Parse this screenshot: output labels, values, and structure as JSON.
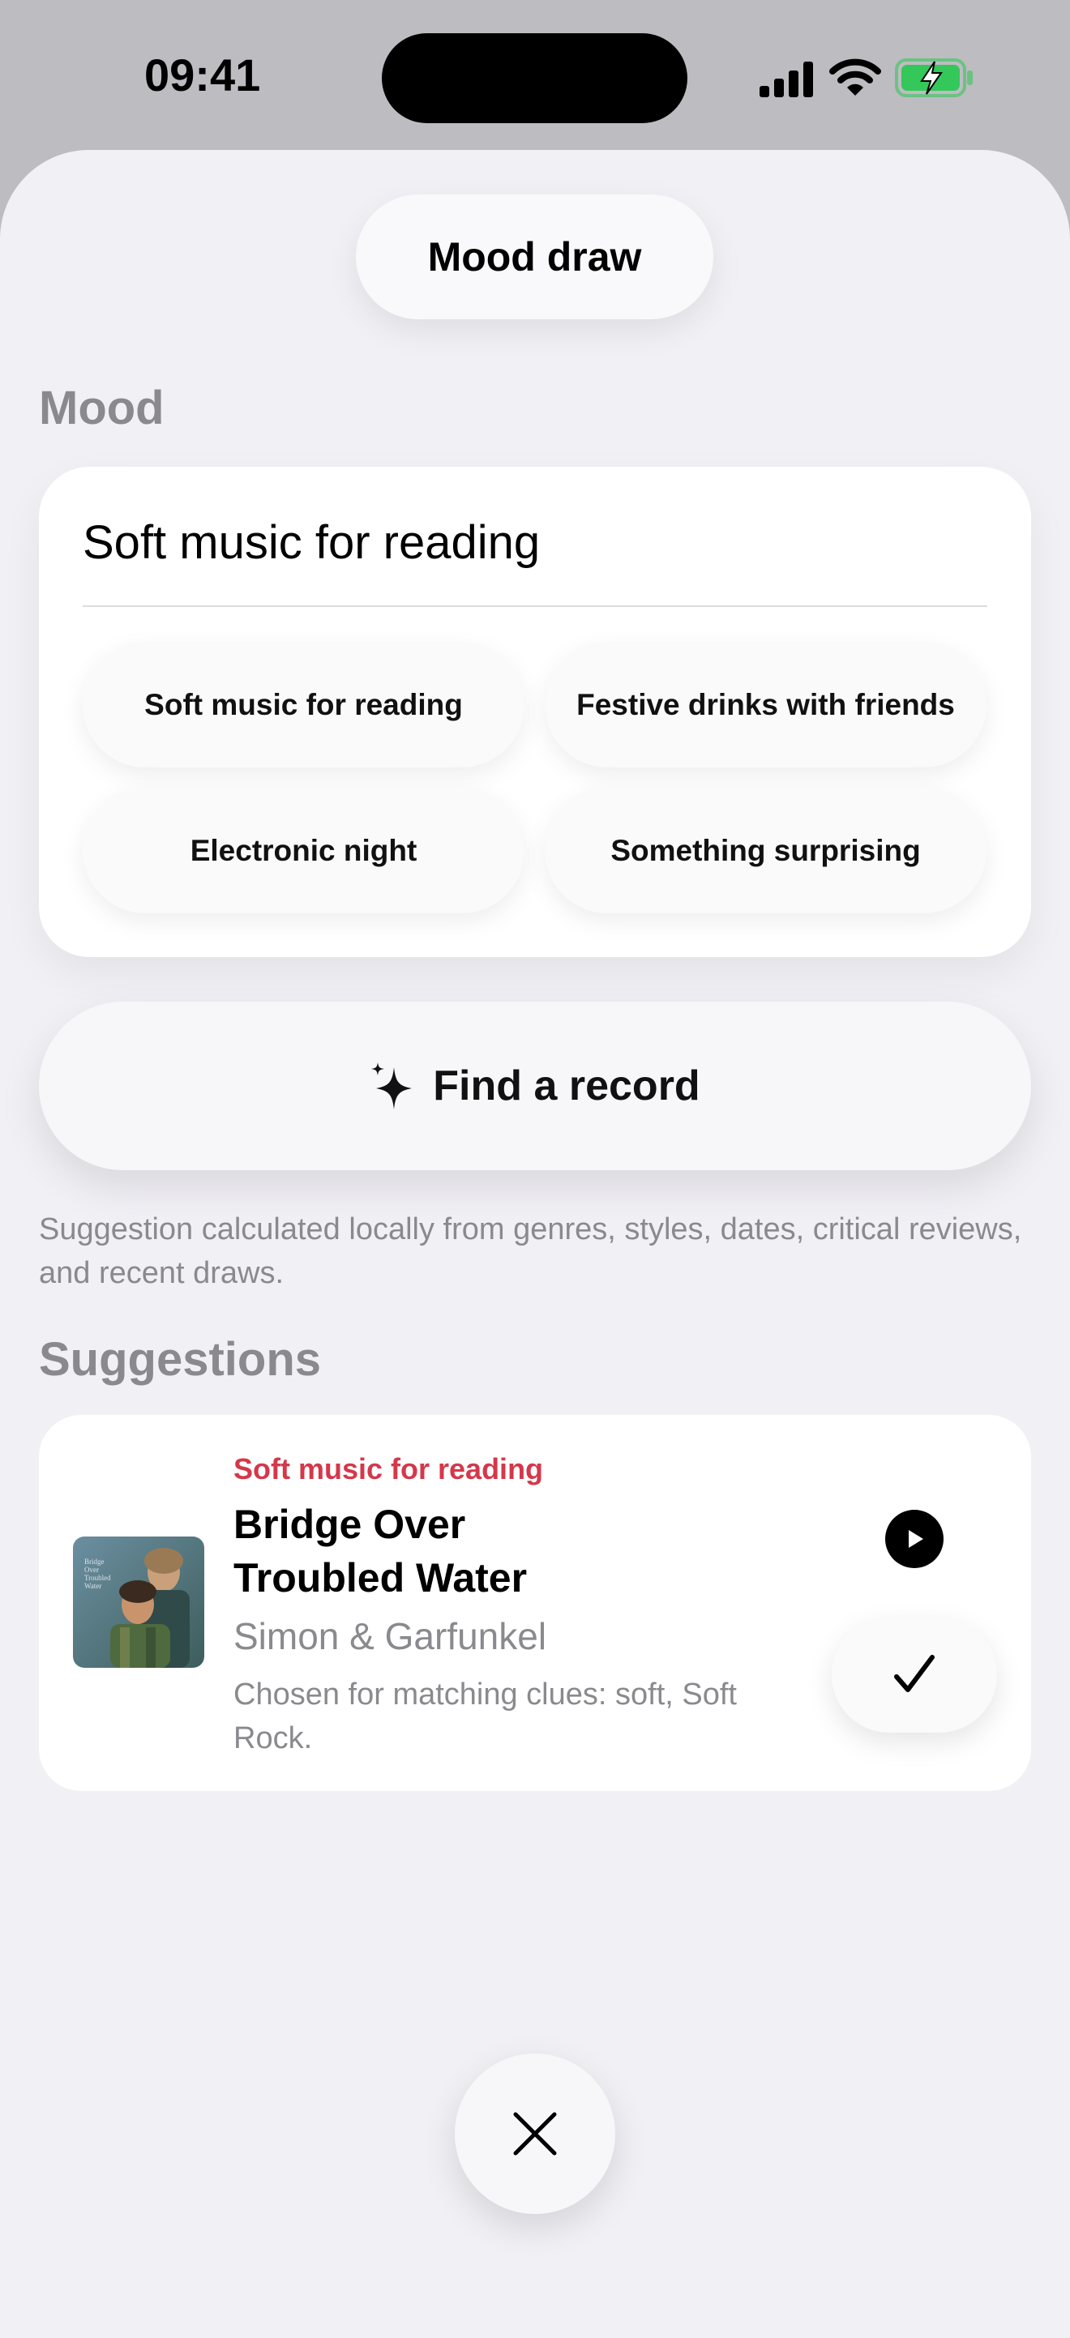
{
  "status_bar": {
    "time": "09:41",
    "icons": [
      "cellular-signal-icon",
      "wifi-icon",
      "battery-charging-icon"
    ]
  },
  "header": {
    "title": "Mood draw"
  },
  "mood": {
    "section_label": "Mood",
    "input_value": "Soft music for reading",
    "presets": [
      "Soft music for reading",
      "Festive drinks with friends",
      "Electronic night",
      "Something surprising"
    ]
  },
  "find_button": {
    "label": "Find a record",
    "icon": "sparkles-icon"
  },
  "footnote": "Suggestion calculated locally from genres, styles, dates, critical reviews, and recent draws.",
  "suggestions": {
    "section_label": "Suggestions",
    "items": [
      {
        "tag": "Soft music for reading",
        "title": "Bridge Over Troubled Water",
        "artist": "Simon & Garfunkel",
        "reason": "Chosen for matching clues: soft, Soft Rock.",
        "cover_text": "Bridge Over Troubled Water"
      }
    ]
  },
  "colors": {
    "accent_red": "#d4384a",
    "sheet_background": "#f1f0f5",
    "secondary_text": "#8a8a8e",
    "battery_green": "#34c759"
  }
}
